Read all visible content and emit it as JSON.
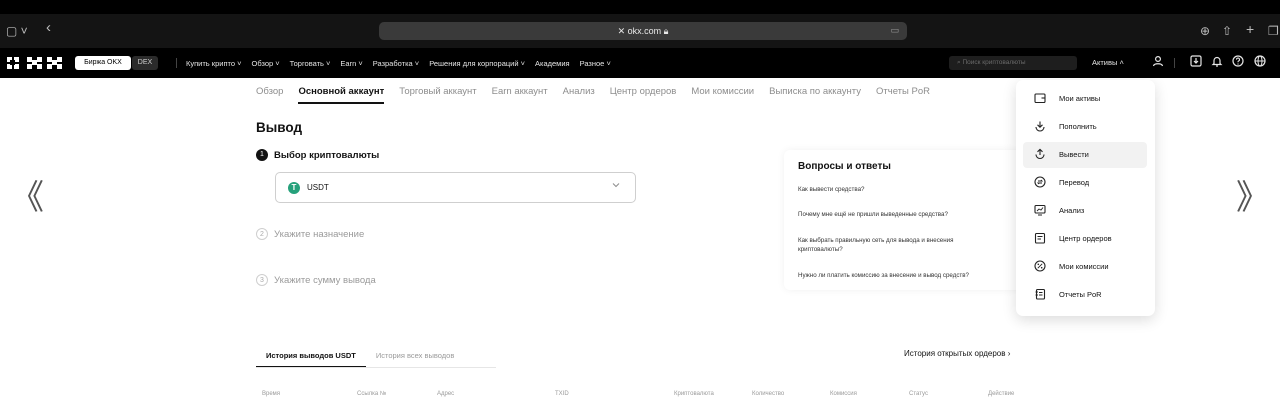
{
  "browser": {
    "url": "okx.com",
    "sidebar_icon": "▢ ˅",
    "back_icon": "‹",
    "right_icons": [
      "⊕",
      "⇧",
      "+",
      "❐"
    ]
  },
  "nav": {
    "logo_text": "OKX",
    "exchange_label": "Биржа OKX",
    "dex_label": "DEX",
    "menu": [
      "Купить крипто ˅",
      "Обзор ˅",
      "Торговать ˅",
      "Earn ˅",
      "Разработка ˅",
      "Решения для корпораций ˅",
      "Академия",
      "Разное ˅"
    ],
    "search_placeholder": "Поиск криптовалюты",
    "assets_label": "Активы ˄"
  },
  "subtabs": [
    {
      "label": "Обзор",
      "active": false
    },
    {
      "label": "Основной аккаунт",
      "active": true
    },
    {
      "label": "Торговый аккаунт",
      "active": false
    },
    {
      "label": "Earn аккаунт",
      "active": false
    },
    {
      "label": "Анализ",
      "active": false
    },
    {
      "label": "Центр ордеров",
      "active": false
    },
    {
      "label": "Мои комиссии",
      "active": false
    },
    {
      "label": "Выписка по аккаунту",
      "active": false
    },
    {
      "label": "Отчеты PoR",
      "active": false
    }
  ],
  "page": {
    "title": "Вывод",
    "steps": [
      {
        "num": "1",
        "label": "Выбор криптовалюты"
      },
      {
        "num": "2",
        "label": "Укажите назначение"
      },
      {
        "num": "3",
        "label": "Укажите сумму вывода"
      }
    ],
    "coin": {
      "symbol": "USDT",
      "icon": "T"
    }
  },
  "faq": {
    "title": "Вопросы и ответы",
    "questions": [
      "Как вывести средства?",
      "Почему мне ещё не пришли выведенные средства?",
      "Как выбрать правильную сеть для вывода и внесения криптовалюты?",
      "Нужно ли платить комиссию за внесение и вывод средств?"
    ]
  },
  "dropdown": {
    "items": [
      {
        "label": "Мои активы",
        "icon": "wallet-icon",
        "active": false
      },
      {
        "label": "Пополнить",
        "icon": "deposit-icon",
        "active": false
      },
      {
        "label": "Вывести",
        "icon": "withdraw-icon",
        "active": true
      },
      {
        "label": "Перевод",
        "icon": "transfer-icon",
        "active": false
      },
      {
        "label": "Анализ",
        "icon": "analysis-icon",
        "active": false
      },
      {
        "label": "Центр ордеров",
        "icon": "orders-icon",
        "active": false
      },
      {
        "label": "Мои комиссии",
        "icon": "fees-icon",
        "active": false
      },
      {
        "label": "Отчеты PoR",
        "icon": "reports-icon",
        "active": false
      }
    ]
  },
  "arrows": {
    "left": "《",
    "right": "》"
  },
  "history": {
    "tabs": [
      {
        "label": "История выводов USDT",
        "active": true
      },
      {
        "label": "История всех выводов",
        "active": false
      }
    ],
    "open_orders": "История открытых ордеров ›",
    "columns": [
      "Время",
      "Ссылка №",
      "Адрес",
      "TXID",
      "Криптовалюта",
      "Количество",
      "Комиссия",
      "Статус",
      "Действие"
    ]
  },
  "colors": {
    "nav_bg": "#000000",
    "accent": "#121212",
    "usdt": "#26a17b"
  }
}
